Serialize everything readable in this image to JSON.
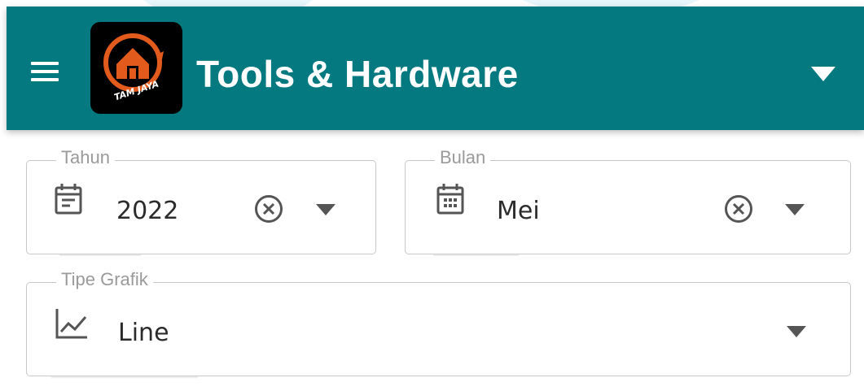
{
  "app": {
    "title": "Tools & Hardware",
    "logo_text": "TAM JAYA",
    "brand_color": "#047a80",
    "logo_accent": "#e25a1c"
  },
  "icons": {
    "menu": "hamburger-menu-icon",
    "header_dropdown": "caret-down-icon",
    "year": "calendar-month-icon",
    "month": "calendar-grid-icon",
    "chart_type": "line-chart-icon",
    "clear": "close-circle-icon"
  },
  "filters": {
    "tahun": {
      "label": "Tahun",
      "value": "2022"
    },
    "bulan": {
      "label": "Bulan",
      "value": "Mei"
    },
    "tipe_grafik": {
      "label": "Tipe Grafik",
      "value": "Line"
    }
  }
}
